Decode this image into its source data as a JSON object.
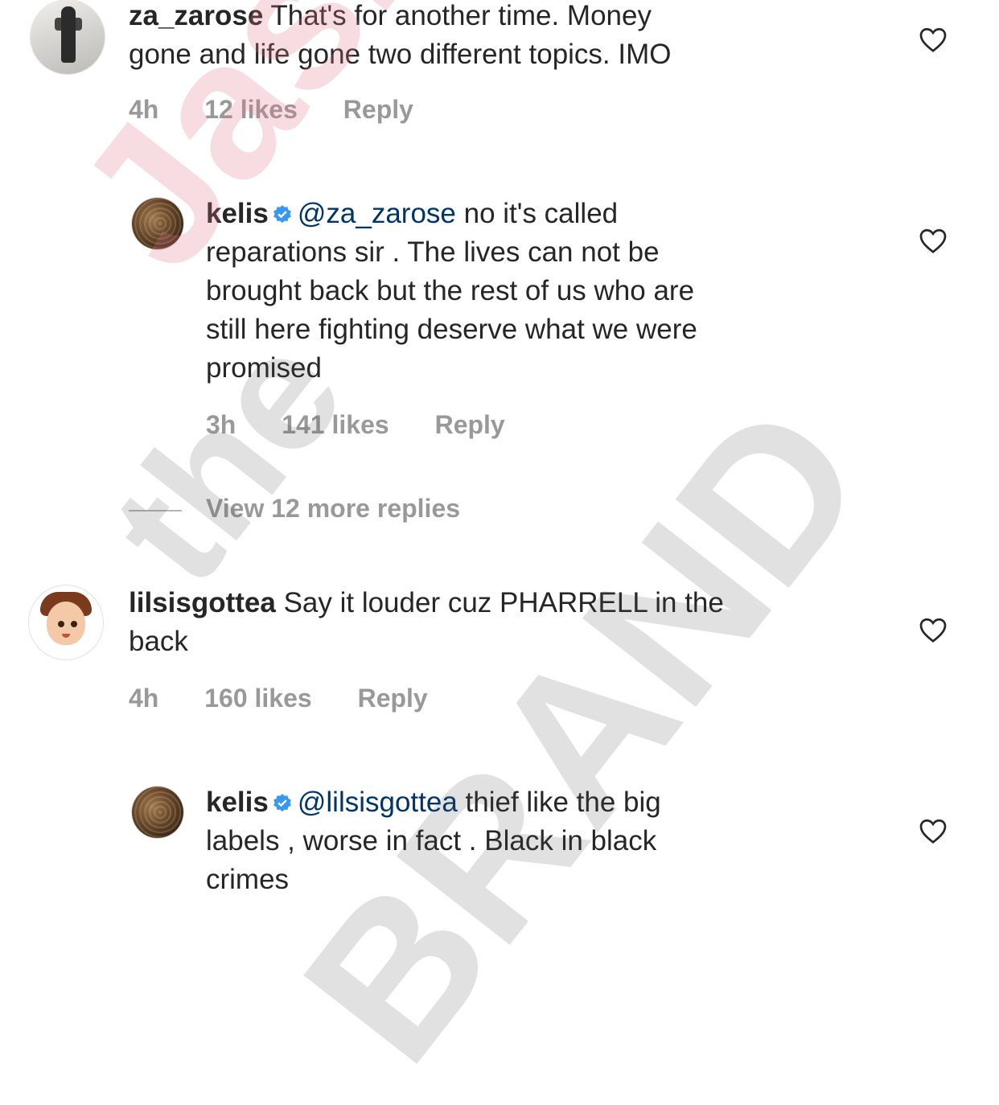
{
  "comments": [
    {
      "username": "za_zarose",
      "verified": false,
      "lines": [
        "That's for another time. Money",
        "gone and life gone two different topics. IMO"
      ],
      "time": "4h",
      "likes": "12 likes",
      "reply_label": "Reply",
      "avatar_icon": "user-photo"
    },
    {
      "username": "kelis",
      "verified": true,
      "mention": "@za_zarose",
      "lines": [
        "no it's called",
        "reparations sir . The lives can not be",
        "brought back but the rest of us who are",
        "still here fighting deserve what we were",
        "promised"
      ],
      "time": "3h",
      "likes": "141 likes",
      "reply_label": "Reply",
      "avatar_icon": "user-photo"
    },
    {
      "username": "lilsisgottea",
      "verified": false,
      "lines": [
        "Say it louder cuz PHARRELL in the",
        "back"
      ],
      "time": "4h",
      "likes": "160 likes",
      "reply_label": "Reply",
      "avatar_icon": "memoji-avatar"
    },
    {
      "username": "kelis",
      "verified": true,
      "mention": "@lilsisgottea",
      "lines": [
        "thief like the big",
        "labels , worse in fact . Black in black",
        "crimes"
      ],
      "avatar_icon": "user-photo"
    }
  ],
  "view_more_replies": "View 12 more replies",
  "watermark": {
    "line1": "the",
    "line2": "Jasmine",
    "line3": "BRAND"
  },
  "colors": {
    "text": "#262626",
    "meta": "#999999",
    "mention": "#003569",
    "verified": "#3897f0",
    "watermark_pink": "#e1788c",
    "watermark_gray": "#505050"
  }
}
